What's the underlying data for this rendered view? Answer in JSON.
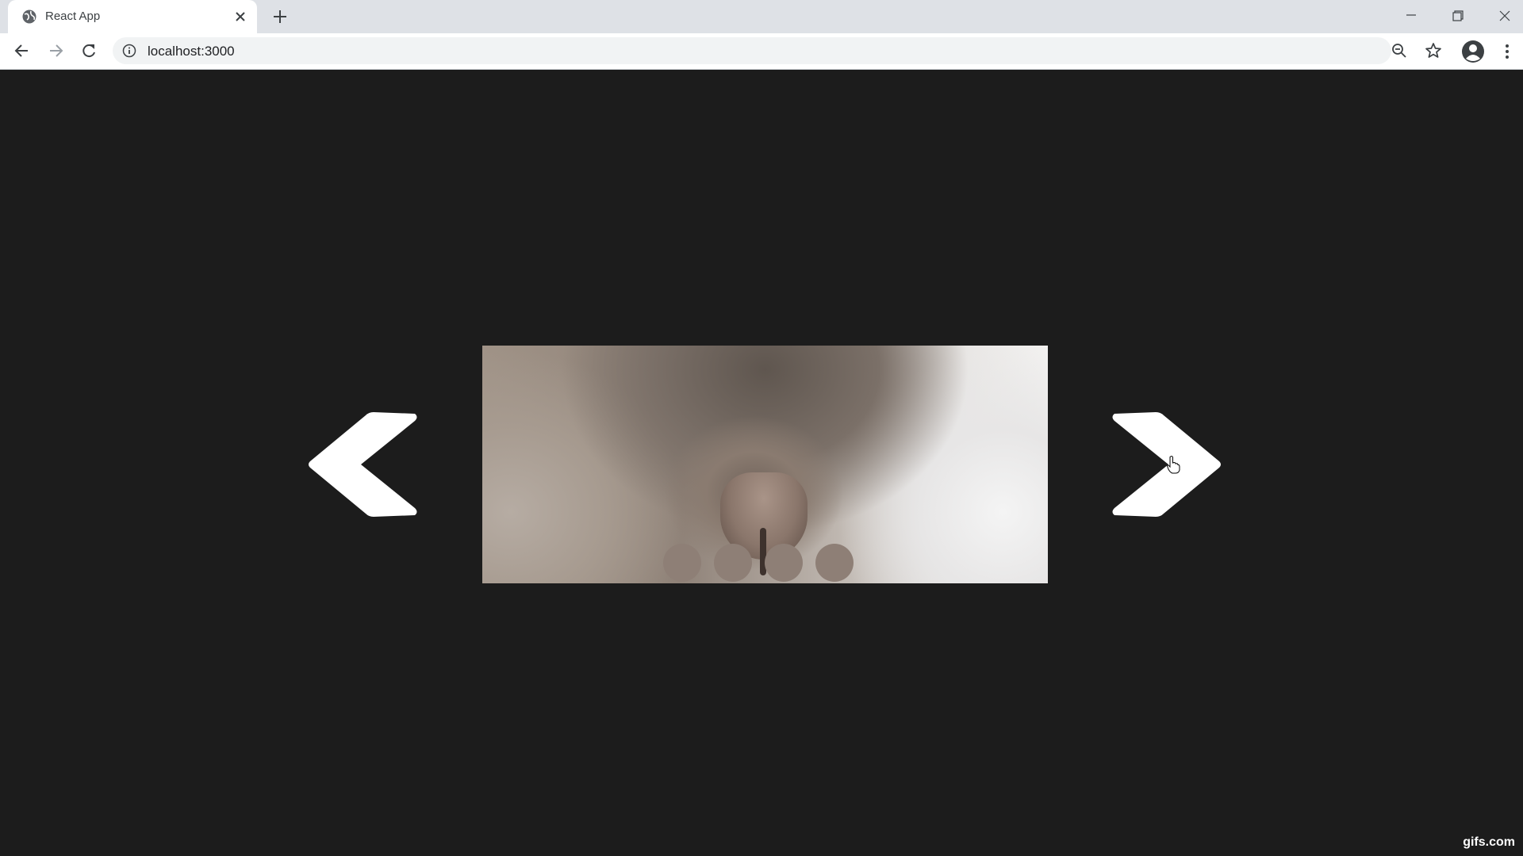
{
  "browser": {
    "tab": {
      "title": "React App",
      "favicon": "globe-icon"
    },
    "address_bar": {
      "url": "localhost:3000"
    },
    "toolbar_icons": [
      "back-arrow-icon",
      "forward-arrow-icon",
      "reload-icon",
      "info-icon",
      "zoom-out-icon",
      "star-icon",
      "profile-icon",
      "menu-icon"
    ]
  },
  "carousel": {
    "image_description_icon": "cat-nose-photo",
    "dot_count": 4,
    "arrow_left": "chevron-left-icon",
    "arrow_right": "chevron-right-icon"
  },
  "watermark": {
    "text": "gifs.com"
  },
  "colors": {
    "page_background": "#1c1c1c",
    "arrow_color": "#ffffff",
    "dot_color": "#8e7f76"
  }
}
